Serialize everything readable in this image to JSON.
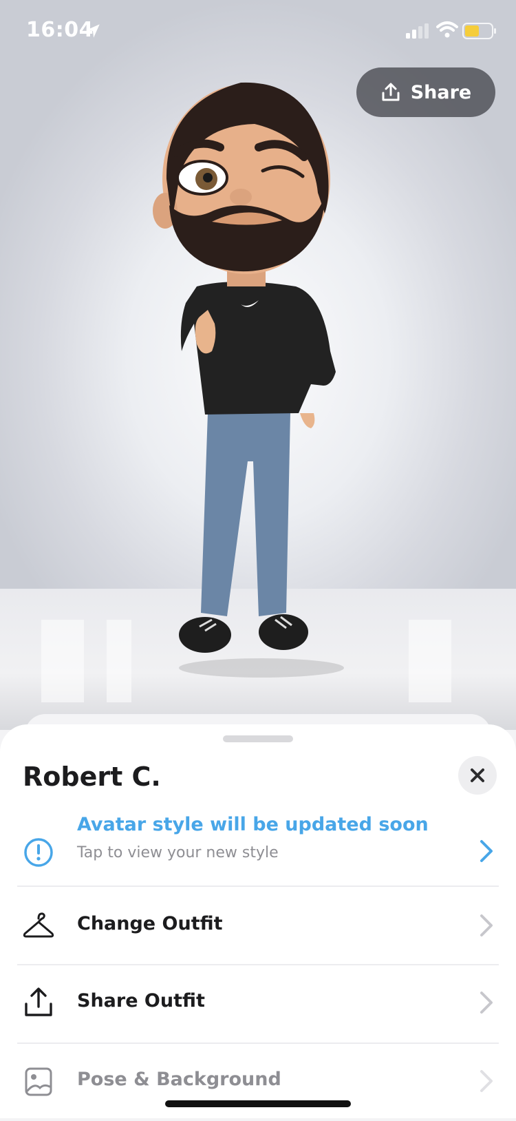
{
  "status_bar": {
    "time": "16:04",
    "icons": [
      "location-arrow-icon",
      "cellular-signal-icon",
      "wifi-icon",
      "battery-icon"
    ],
    "battery_color": "#f5cd3b"
  },
  "header": {
    "share_label": "Share",
    "share_icon": "upload-icon"
  },
  "sheet": {
    "title": "Robert C.",
    "close_icon": "close-icon",
    "notice": {
      "title": "Avatar style will be updated soon",
      "subtitle": "Tap to view your new style",
      "icon": "info-alert-icon",
      "accent": "#48a6e8"
    },
    "items": [
      {
        "label": "Change Outfit",
        "icon": "hanger-icon"
      },
      {
        "label": "Share Outfit",
        "icon": "upload-icon"
      },
      {
        "label": "Pose & Background",
        "icon": "image-icon"
      }
    ]
  }
}
